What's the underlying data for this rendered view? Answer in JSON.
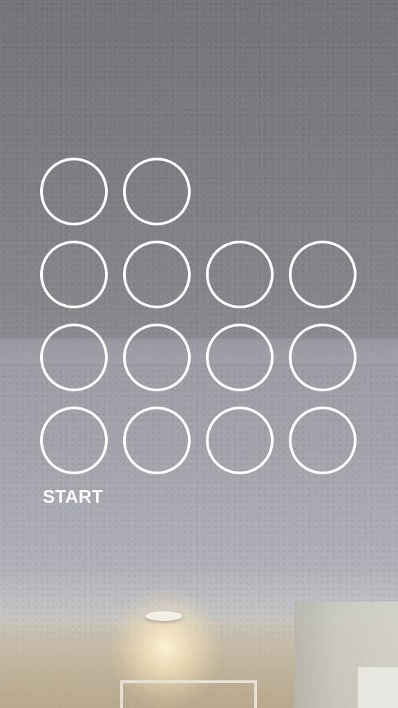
{
  "colors": {
    "ring": "#ffffff",
    "label": "#ffffff"
  },
  "lock_pattern": {
    "rows": [
      {
        "count": 2
      },
      {
        "count": 4
      },
      {
        "count": 4
      },
      {
        "count": 4
      }
    ],
    "start_label": "START"
  }
}
